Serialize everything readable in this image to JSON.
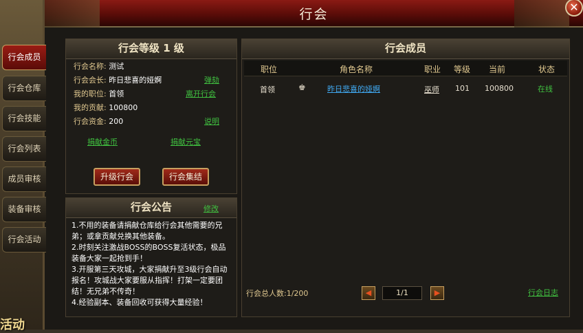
{
  "window": {
    "title": "行会"
  },
  "tabs": [
    {
      "label": "行会成员",
      "active": true
    },
    {
      "label": "行会仓库"
    },
    {
      "label": "行会技能"
    },
    {
      "label": "行会列表"
    },
    {
      "label": "成员审核"
    },
    {
      "label": "装备审核"
    },
    {
      "label": "行会活动"
    }
  ],
  "background": {
    "activity_text": "活动"
  },
  "info": {
    "header": "行会等级  1  级",
    "name_label": "行会名称:",
    "name_value": "测试",
    "leader_label": "行会会长:",
    "leader_value": "昨日悲喜的娅婀",
    "impeach_link": "弹劾",
    "position_label": "我的职位:",
    "position_value": "首领",
    "leave_link": "离开行会",
    "contribution_label": "我的贡献:",
    "contribution_value": "100800",
    "funds_label": "行会资金:",
    "funds_value": "200",
    "explain_link": "说明",
    "donate_gold_link": "捐献金币",
    "donate_yuanbao_link": "捐献元宝",
    "upgrade_button": "升级行会",
    "gather_button": "行会集结"
  },
  "notice": {
    "header": "行会公告",
    "edit_link": "修改",
    "lines": [
      "1.不用的装备请捐献仓库给行会其他需要的兄弟；或拿贡献兑换其他装备。",
      "2.时刻关注激战BOSS的BOSS复活状态，极品装备大家一起抢到手！",
      "3.开服第三天攻城，大家捐献升至3级行会自动报名！攻城战大家要服从指挥！打架一定要团结！无兄弟不传奇！",
      "4.经验副本、装备回收可获得大量经验！"
    ]
  },
  "members": {
    "header": "行会成员",
    "columns": [
      "职位",
      "角色名称",
      "职业",
      "等级",
      "当前",
      "状态"
    ],
    "rows": [
      {
        "position": "首领",
        "name": "昨日悲喜的娅婀",
        "class": "巫师",
        "level": "101",
        "current": "100800",
        "status": "在线"
      }
    ],
    "total_label": "行会总人数:1/200",
    "page": "1/1",
    "log_link": "行会日志"
  },
  "colors": {
    "accent_red": "#8a1a14",
    "link_green": "#40c040",
    "online_green": "#40c040",
    "name_blue": "#40a8f0"
  }
}
